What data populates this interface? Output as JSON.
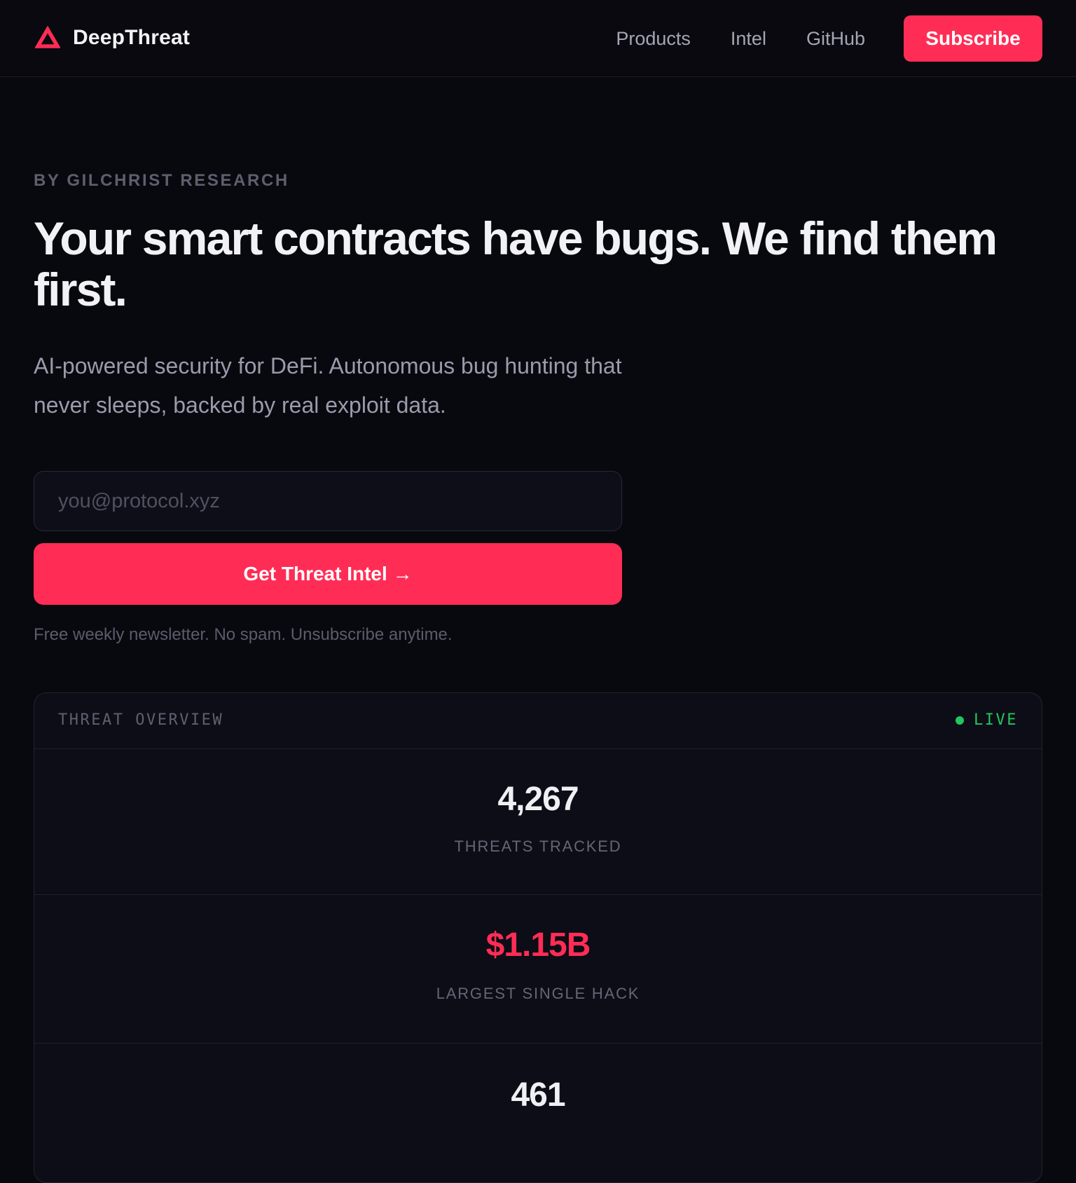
{
  "header": {
    "brand_name": "DeepThreat",
    "nav": [
      "Products",
      "Intel",
      "GitHub"
    ],
    "subscribe_label": "Subscribe"
  },
  "hero": {
    "eyebrow": "BY GILCHRIST RESEARCH",
    "headline": "Your smart contracts have bugs. We find them first.",
    "subhead": "AI-powered security for DeFi. Autonomous bug hunting that never sleeps, backed by real exploit data.",
    "email_placeholder": "you@protocol.xyz",
    "cta_label": "Get Threat Intel →",
    "fineprint": "Free weekly newsletter. No spam. Unsubscribe anytime."
  },
  "overview": {
    "title": "THREAT OVERVIEW",
    "status": "LIVE",
    "stats": [
      {
        "value": "4,267",
        "label": "THREATS TRACKED"
      },
      {
        "value": "$1.15B",
        "label": "LARGEST SINGLE HACK"
      },
      {
        "value": "461",
        "label": ""
      }
    ]
  },
  "colors": {
    "accent": "#ff2d55",
    "live": "#22c55e",
    "background": "#08090e"
  },
  "icons": {
    "brand": "triangle-logo-icon"
  }
}
